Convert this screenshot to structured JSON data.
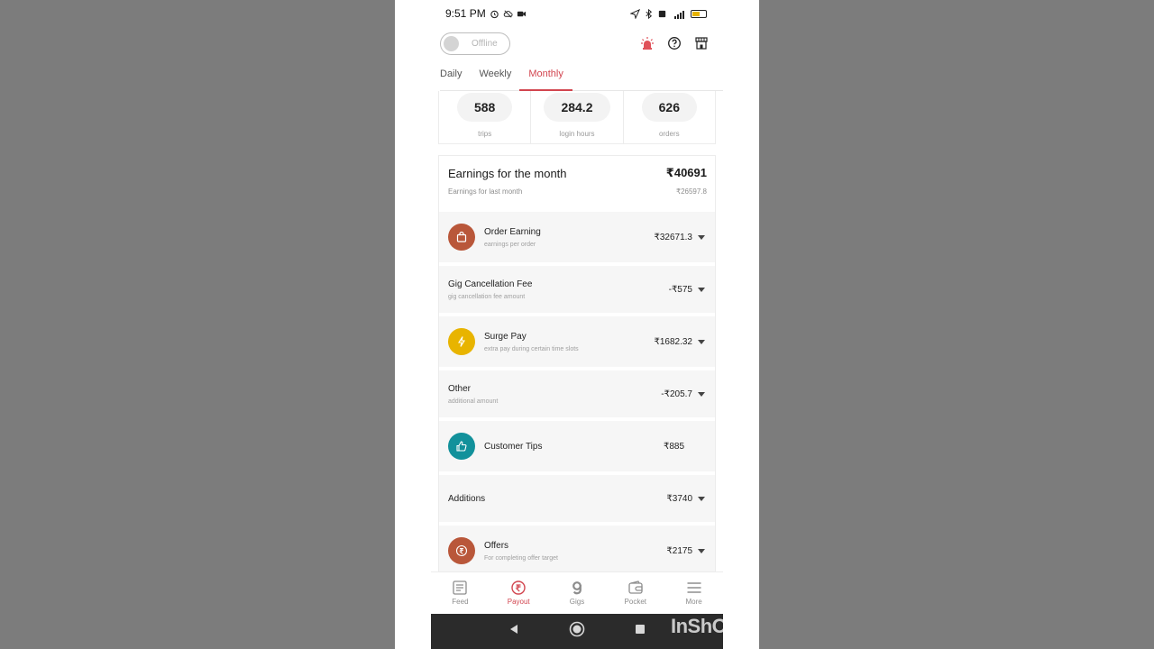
{
  "status_bar": {
    "time": "9:51 PM"
  },
  "topbar": {
    "status_label": "Offline"
  },
  "tabs": [
    {
      "label": "Daily",
      "active": false
    },
    {
      "label": "Weekly",
      "active": false
    },
    {
      "label": "Monthly",
      "active": true
    }
  ],
  "stats": [
    {
      "value": "588",
      "caption": "trips"
    },
    {
      "value": "284.2",
      "caption": "login hours"
    },
    {
      "value": "626",
      "caption": "orders"
    }
  ],
  "earnings": {
    "title": "Earnings for the month",
    "total": "₹40691",
    "last_label": "Earnings for last month",
    "last_value": "₹26597.8",
    "items": [
      {
        "name": "Order Earning",
        "desc": "earnings per order",
        "amount": "₹32671.3",
        "icon": "shopping-bag-icon",
        "icon_color": "#b9573a"
      },
      {
        "name": "Gig Cancellation Fee",
        "desc": "gig cancellation fee amount",
        "amount": "-₹575"
      },
      {
        "name": "Surge Pay",
        "desc": "extra pay during certain time slots",
        "amount": "₹1682.32",
        "icon": "lightning-icon",
        "icon_color": "#e8b400"
      },
      {
        "name": "Other",
        "desc": "additional amount",
        "amount": "-₹205.7"
      },
      {
        "name": "Customer Tips",
        "desc": "",
        "amount": "₹885",
        "icon": "thumbs-up-icon",
        "icon_color": "#12919b"
      },
      {
        "name": "Additions",
        "desc": "",
        "amount": "₹3740"
      },
      {
        "name": "Offers",
        "desc": "For completing offer target",
        "amount": "₹2175",
        "icon": "rupee-circle-icon",
        "icon_color": "#b9573a"
      }
    ]
  },
  "bottom_nav": [
    {
      "label": "Feed",
      "icon": "feed-icon",
      "active": false
    },
    {
      "label": "Payout",
      "icon": "rupee-icon",
      "active": true
    },
    {
      "label": "Gigs",
      "icon": "gigs-icon",
      "active": false
    },
    {
      "label": "Pocket",
      "icon": "wallet-icon",
      "active": false
    },
    {
      "label": "More",
      "icon": "menu-icon",
      "active": false
    }
  ],
  "watermark": "InShOt",
  "colors": {
    "accent": "#d2454f",
    "card_bg": "#f6f6f6"
  }
}
